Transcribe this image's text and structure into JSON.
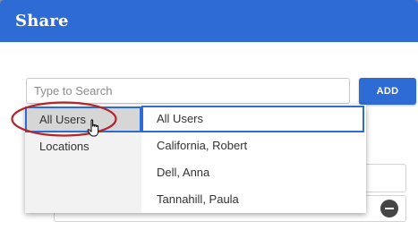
{
  "dialog": {
    "title": "Share"
  },
  "search": {
    "placeholder": "Type to Search",
    "value": ""
  },
  "add_button": {
    "label": "ADD"
  },
  "dropdown": {
    "categories": [
      {
        "label": "All Users",
        "selected": true
      },
      {
        "label": "Locations",
        "selected": false
      }
    ],
    "items": [
      {
        "label": "All Users",
        "highlighted": true
      },
      {
        "label": "California, Robert",
        "highlighted": false
      },
      {
        "label": "Dell, Anna",
        "highlighted": false
      },
      {
        "label": "Tannahill, Paula",
        "highlighted": false
      }
    ]
  },
  "colors": {
    "accent": "#2f6bd4",
    "annotation": "#b3262b"
  }
}
